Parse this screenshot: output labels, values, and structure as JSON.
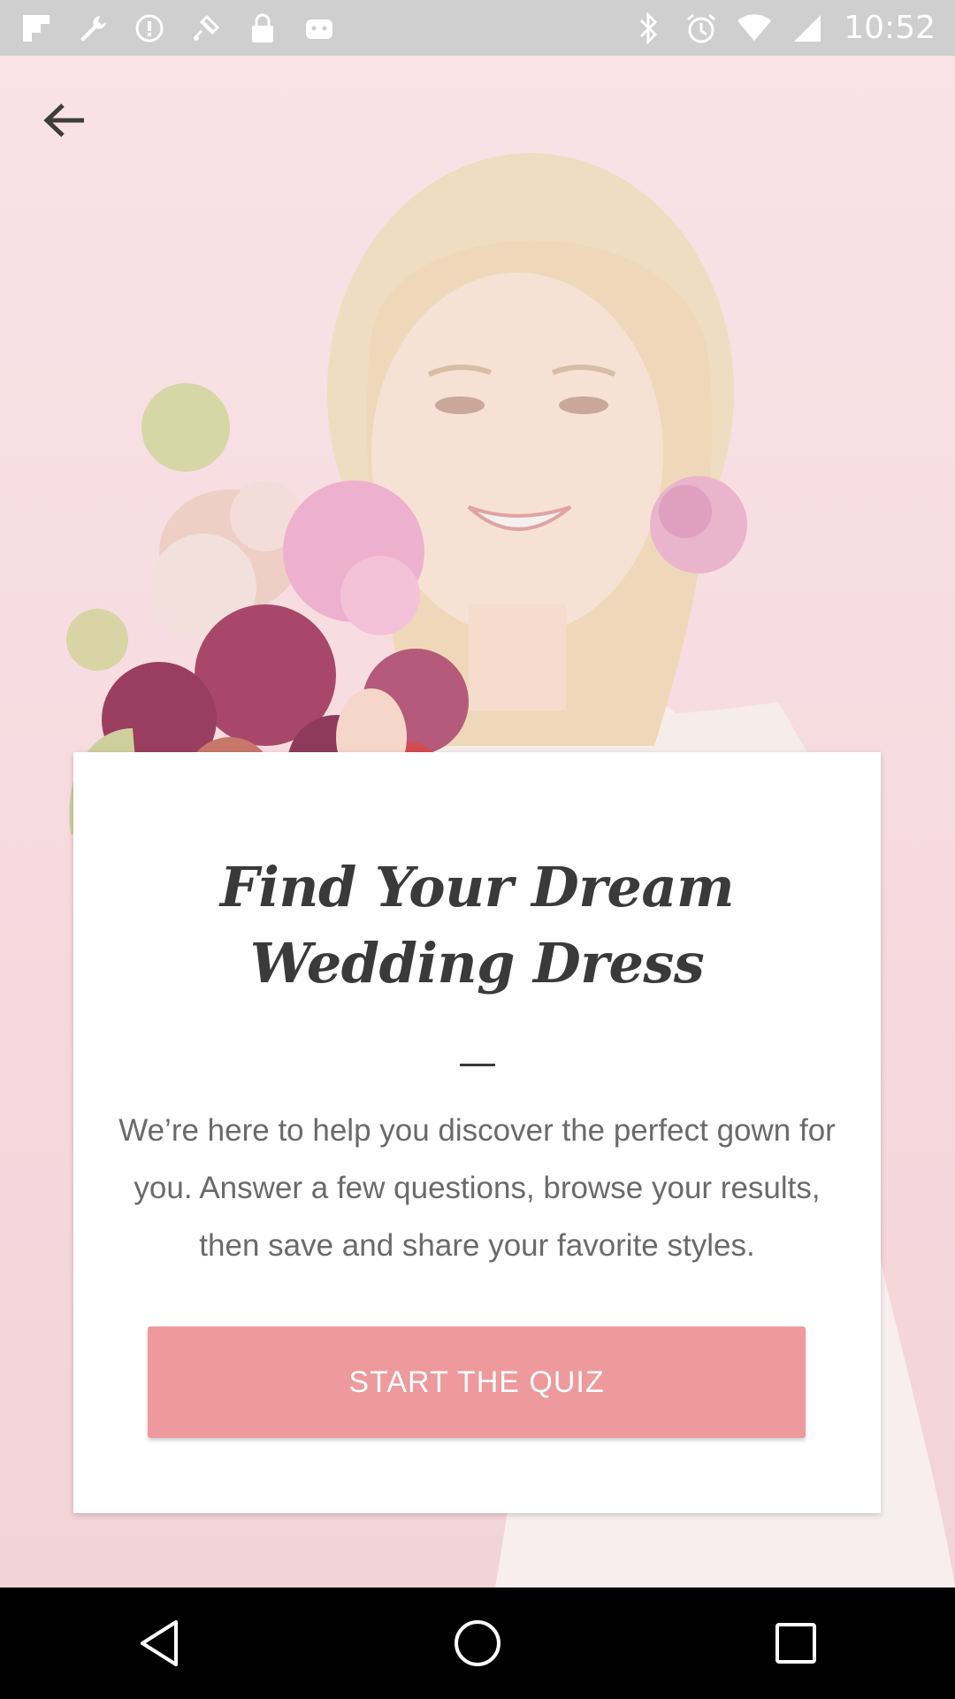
{
  "status_bar": {
    "time": "10:52",
    "left_icons": [
      "flipboard-icon",
      "wrench-icon",
      "alert-icon",
      "fake-gps-icon",
      "lock-icon",
      "android-icon"
    ],
    "right_icons": [
      "bluetooth-icon",
      "alarm-icon",
      "wifi-icon",
      "signal-icon"
    ]
  },
  "header": {
    "back_icon": "arrow-back-icon"
  },
  "card": {
    "title": "Find Your Dream Wedding Dress",
    "body": "We’re here to help you discover the perfect gown for you. Answer a few questions, browse your results, then save and share your favorite styles.",
    "cta_label": "START THE QUIZ"
  },
  "colors": {
    "accent": "#ee999c",
    "background": "#f7dfe2",
    "title_text": "#3a3a3a",
    "body_text": "#6a6a6a"
  },
  "nav_bar": {
    "icons": [
      "back-triangle-icon",
      "home-circle-icon",
      "recents-square-icon"
    ]
  }
}
